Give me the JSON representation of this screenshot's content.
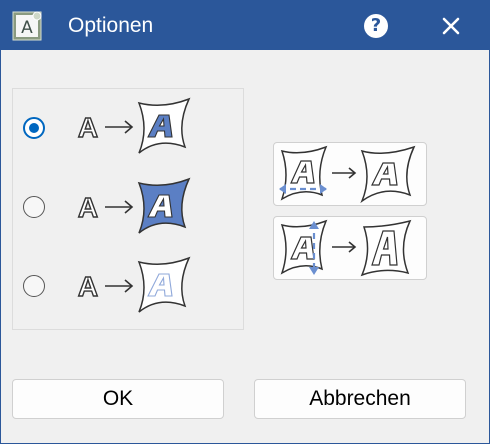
{
  "window": {
    "title": "Optionen",
    "accent": "#2b579a",
    "background": "#f0f0f0",
    "app_icon": "font-settings-icon",
    "help_icon": "question-mark-icon",
    "help_glyph": "?",
    "close_icon": "close-icon"
  },
  "options": [
    {
      "icon": "outline-to-outline-warp-icon",
      "selected": true
    },
    {
      "icon": "outline-to-filled-warp-icon",
      "selected": false
    },
    {
      "icon": "outline-to-faded-warp-icon",
      "selected": false
    }
  ],
  "side_buttons": [
    {
      "icon": "warp-horizontal-icon"
    },
    {
      "icon": "warp-vertical-icon"
    }
  ],
  "buttons": {
    "ok": "OK",
    "cancel": "Abbrechen"
  },
  "colors": {
    "radio_checked": "#0067c0",
    "card_fill": "#5b7fc4",
    "arrow_accent": "#6b8fd0"
  }
}
